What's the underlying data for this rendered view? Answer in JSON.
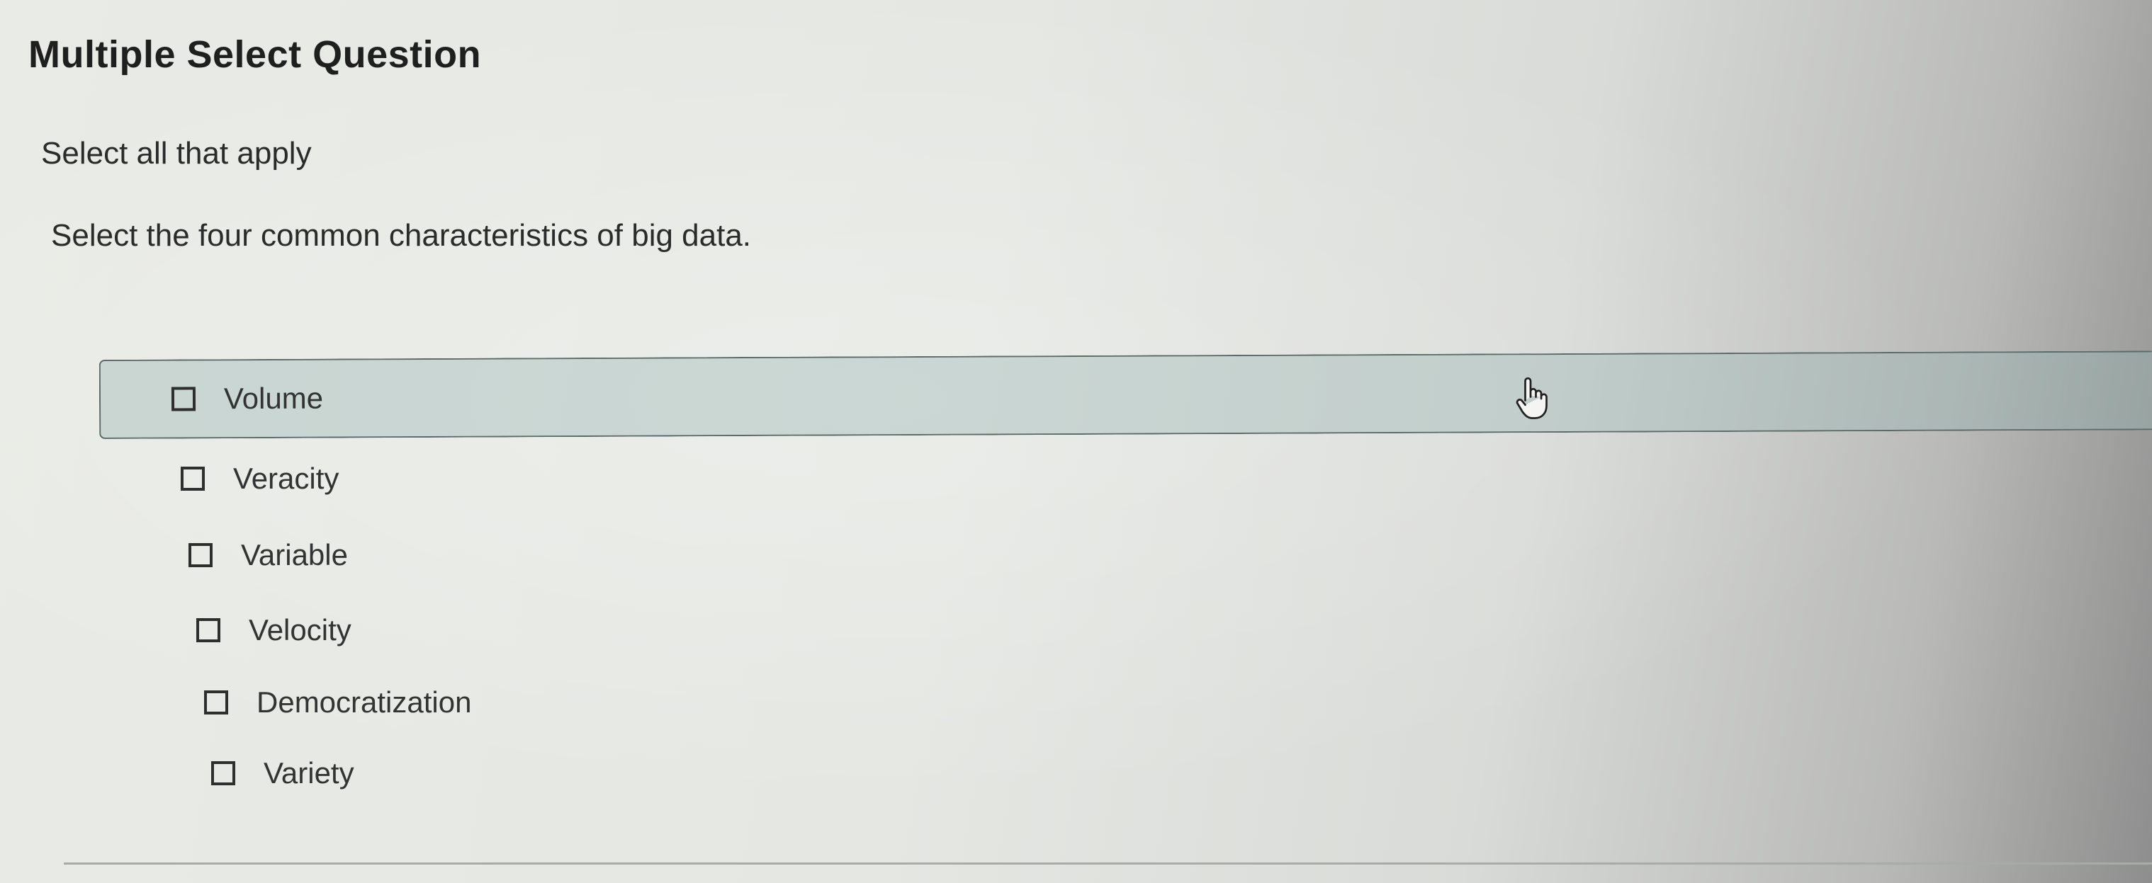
{
  "question": {
    "type_label": "Multiple Select Question",
    "instruction": "Select all that apply",
    "prompt": "Select the four common characteristics of big data."
  },
  "options": [
    {
      "label": "Volume",
      "checked": false,
      "hovered": true
    },
    {
      "label": "Veracity",
      "checked": false
    },
    {
      "label": "Variable",
      "checked": false
    },
    {
      "label": "Velocity",
      "checked": false
    },
    {
      "label": "Democratization",
      "checked": false
    },
    {
      "label": "Variety",
      "checked": false
    }
  ],
  "cursor": {
    "icon": "hand-pointer-icon"
  }
}
